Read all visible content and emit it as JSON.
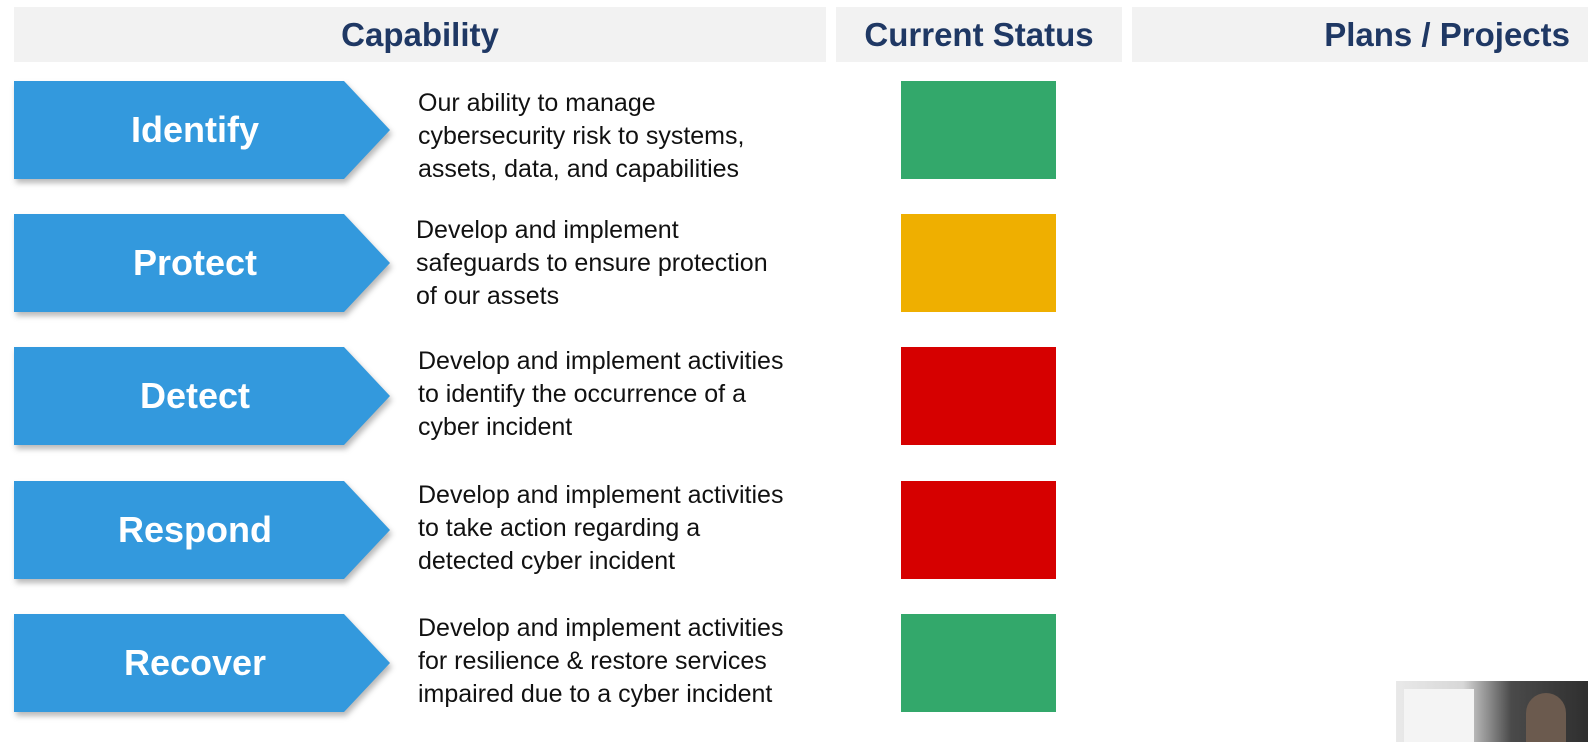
{
  "headers": {
    "capability": "Capability",
    "current_status": "Current Status",
    "plans_projects": "Plans / Projects"
  },
  "colors": {
    "arrow": "#3399dd",
    "green": "#33a86b",
    "yellow": "#efaf00",
    "red": "#d60000"
  },
  "rows": [
    {
      "label": "Identify",
      "lines": [
        "Our ability to manage",
        "cybersecurity risk to systems,",
        "assets, data, and capabilities"
      ],
      "status": "green",
      "status_color": "#33a86b"
    },
    {
      "label": "Protect",
      "lines": [
        "Develop and implement",
        "safeguards to ensure protection",
        "of our assets"
      ],
      "status": "yellow",
      "status_color": "#efaf00"
    },
    {
      "label": "Detect",
      "lines": [
        "Develop and implement activities",
        "to identify the occurrence of a",
        "cyber incident"
      ],
      "status": "red",
      "status_color": "#d60000"
    },
    {
      "label": "Respond",
      "lines": [
        "Develop and implement activities",
        "to take action regarding a",
        "detected cyber incident"
      ],
      "status": "red",
      "status_color": "#d60000"
    },
    {
      "label": "Recover",
      "lines": [
        "Develop and implement activities",
        "for resilience & restore services",
        "impaired due to a cyber incident"
      ],
      "status": "green",
      "status_color": "#33a86b"
    }
  ]
}
